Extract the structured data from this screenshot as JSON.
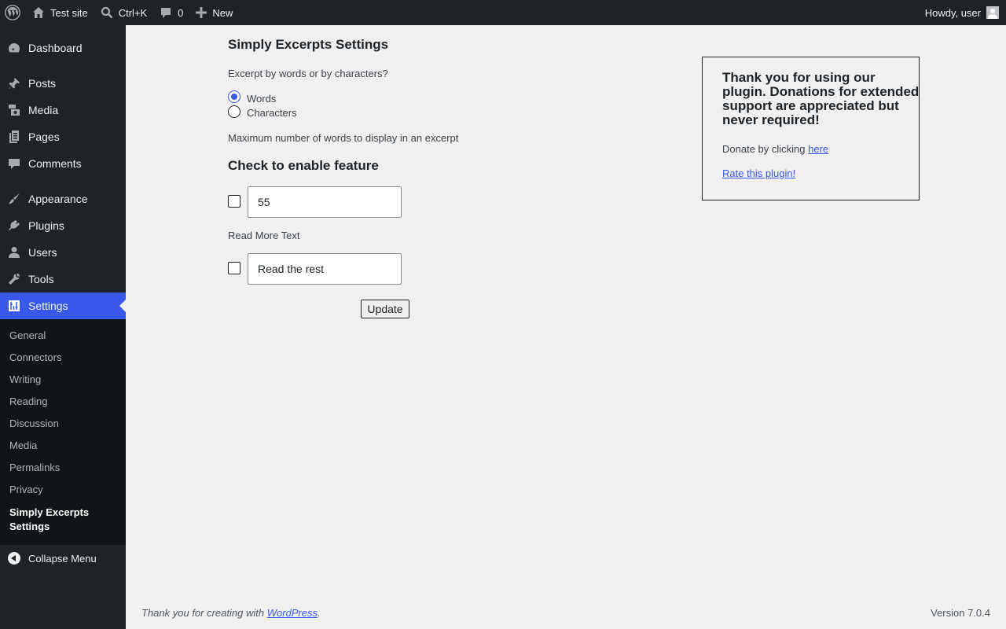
{
  "adminbar": {
    "site_name": "Test site",
    "search_shortcut": "Ctrl+K",
    "comments_count": "0",
    "new_label": "New",
    "howdy": "Howdy, user"
  },
  "sidebar": {
    "items": [
      {
        "label": "Dashboard",
        "icon": "dashboard-icon"
      },
      {
        "label": "Posts",
        "icon": "pin-icon"
      },
      {
        "label": "Media",
        "icon": "media-icon"
      },
      {
        "label": "Pages",
        "icon": "pages-icon"
      },
      {
        "label": "Comments",
        "icon": "comment-icon"
      },
      {
        "label": "Appearance",
        "icon": "paintbrush-icon"
      },
      {
        "label": "Plugins",
        "icon": "plugin-icon"
      },
      {
        "label": "Users",
        "icon": "user-icon"
      },
      {
        "label": "Tools",
        "icon": "wrench-icon"
      },
      {
        "label": "Settings",
        "icon": "settings-icon"
      }
    ],
    "submenu": [
      "General",
      "Connectors",
      "Writing",
      "Reading",
      "Discussion",
      "Media",
      "Permalinks",
      "Privacy",
      "Simply Excerpts Settings"
    ],
    "collapse_label": "Collapse Menu"
  },
  "main": {
    "title": "Simply Excerpts Settings",
    "question": "Excerpt by words or by characters?",
    "radio_words": "Words",
    "radio_characters": "Characters",
    "selected": "Words",
    "max_words_label": "Maximum number of words to display in an excerpt",
    "enable_heading": "Check to enable feature",
    "max_words_value": "55",
    "read_more_label": "Read More Text",
    "read_more_value": "Read the rest",
    "update_button": "Update"
  },
  "donate": {
    "title": "Thank you for using our plugin. Donations for extended support are appreciated but never required!",
    "donate_text": "Donate by clicking ",
    "here_link": "here",
    "rate_link": "Rate this plugin!"
  },
  "footer": {
    "thanks_text": "Thank you for creating with ",
    "wordpress_link": "WordPress",
    "period": ".",
    "version": "Version 7.0.4"
  },
  "colors": {
    "accent": "#3858e9",
    "sidebar_bg": "#1d2327",
    "page_bg": "#f0f0f1"
  }
}
